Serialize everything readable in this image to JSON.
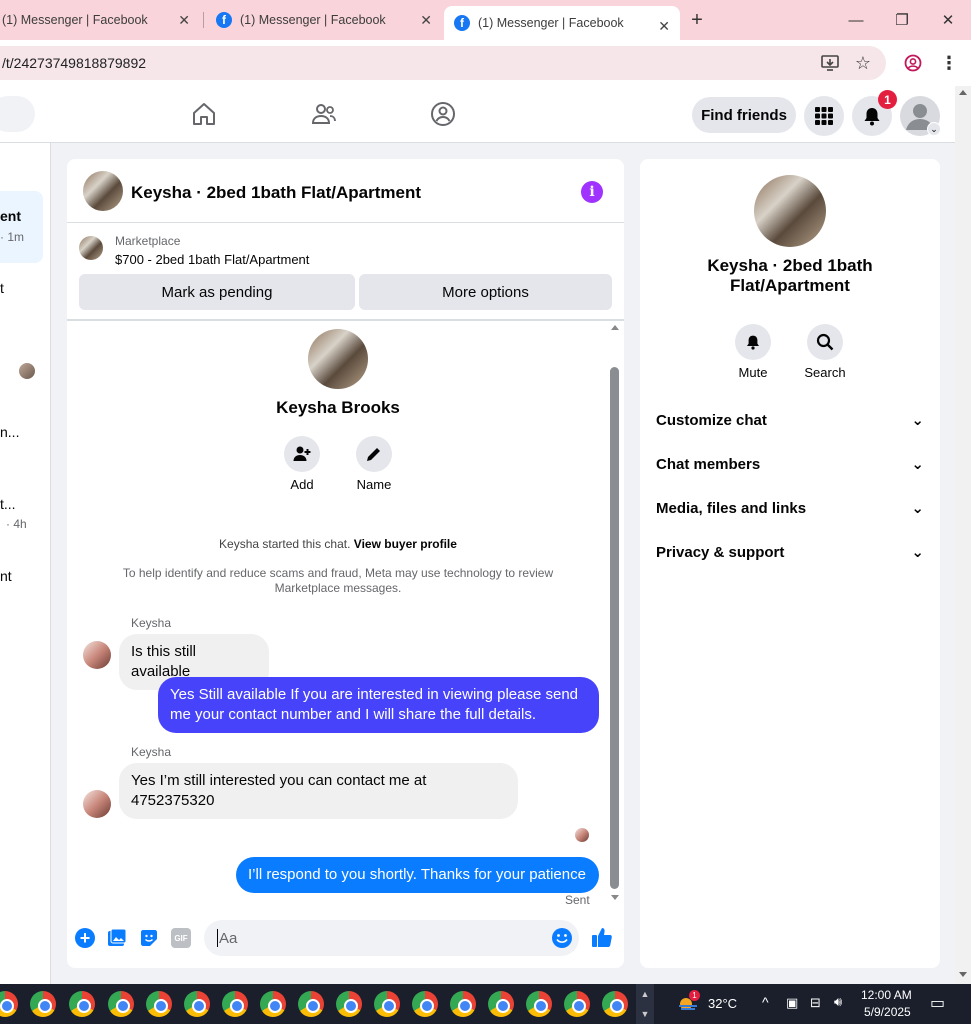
{
  "browser": {
    "tabs": [
      {
        "title": "(1) Messenger | Facebook"
      },
      {
        "title": "(1) Messenger | Facebook"
      },
      {
        "title": "(1) Messenger | Facebook"
      }
    ],
    "url": "/t/24273749818879892",
    "new_tab": "+"
  },
  "fbnav": {
    "find_friends": "Find friends",
    "notification_count": "1"
  },
  "sidebar": {
    "items": [
      {
        "title": "ent",
        "time": "· 1m"
      },
      {
        "title": "t",
        "time": ""
      },
      {
        "title": "n...",
        "time": ""
      },
      {
        "title": "t...",
        "time": "· 4h"
      },
      {
        "title": "nt",
        "time": ""
      }
    ]
  },
  "chat": {
    "title": "Keysha · 2bed 1bath Flat/Apartment",
    "marketplace_label": "Marketplace",
    "listing": "$700 - 2bed 1bath Flat/Apartment",
    "mark_pending": "Mark as pending",
    "more_options": "More options",
    "profile_name": "Keysha Brooks",
    "add_label": "Add",
    "name_label": "Name",
    "started_text": "Keysha started this chat.",
    "view_profile": "View buyer profile",
    "notice": "To help identify and reduce scams and fraud, Meta may use technology to review Marketplace messages.",
    "messages": [
      {
        "sender": "Keysha",
        "text": "Is this still available"
      },
      {
        "sender": "",
        "text": "Yes Still available If you are interested in viewing please send me your contact number and I will share the full details."
      },
      {
        "sender": "Keysha",
        "text": "Yes I’m still interested you can contact me at 4752375320"
      },
      {
        "sender": "",
        "text": "I’ll respond to you shortly. Thanks for your patience"
      }
    ],
    "sent_status": "Sent",
    "composer_placeholder": "Aa",
    "gif": "GIF"
  },
  "details": {
    "title": "Keysha · 2bed 1bath Flat/Apartment",
    "mute": "Mute",
    "search": "Search",
    "sections": [
      "Customize chat",
      "Chat members",
      "Media, files and links",
      "Privacy & support"
    ]
  },
  "taskbar": {
    "temperature": "32°C",
    "weather_badge": "1",
    "time": "12:00 AM",
    "date": "5/9/2025"
  },
  "colors": {
    "accent": "#0a7cff",
    "outgoing_purple": "#4743fa",
    "info_icon": "#a033ff",
    "notification": "#e41e3f"
  }
}
